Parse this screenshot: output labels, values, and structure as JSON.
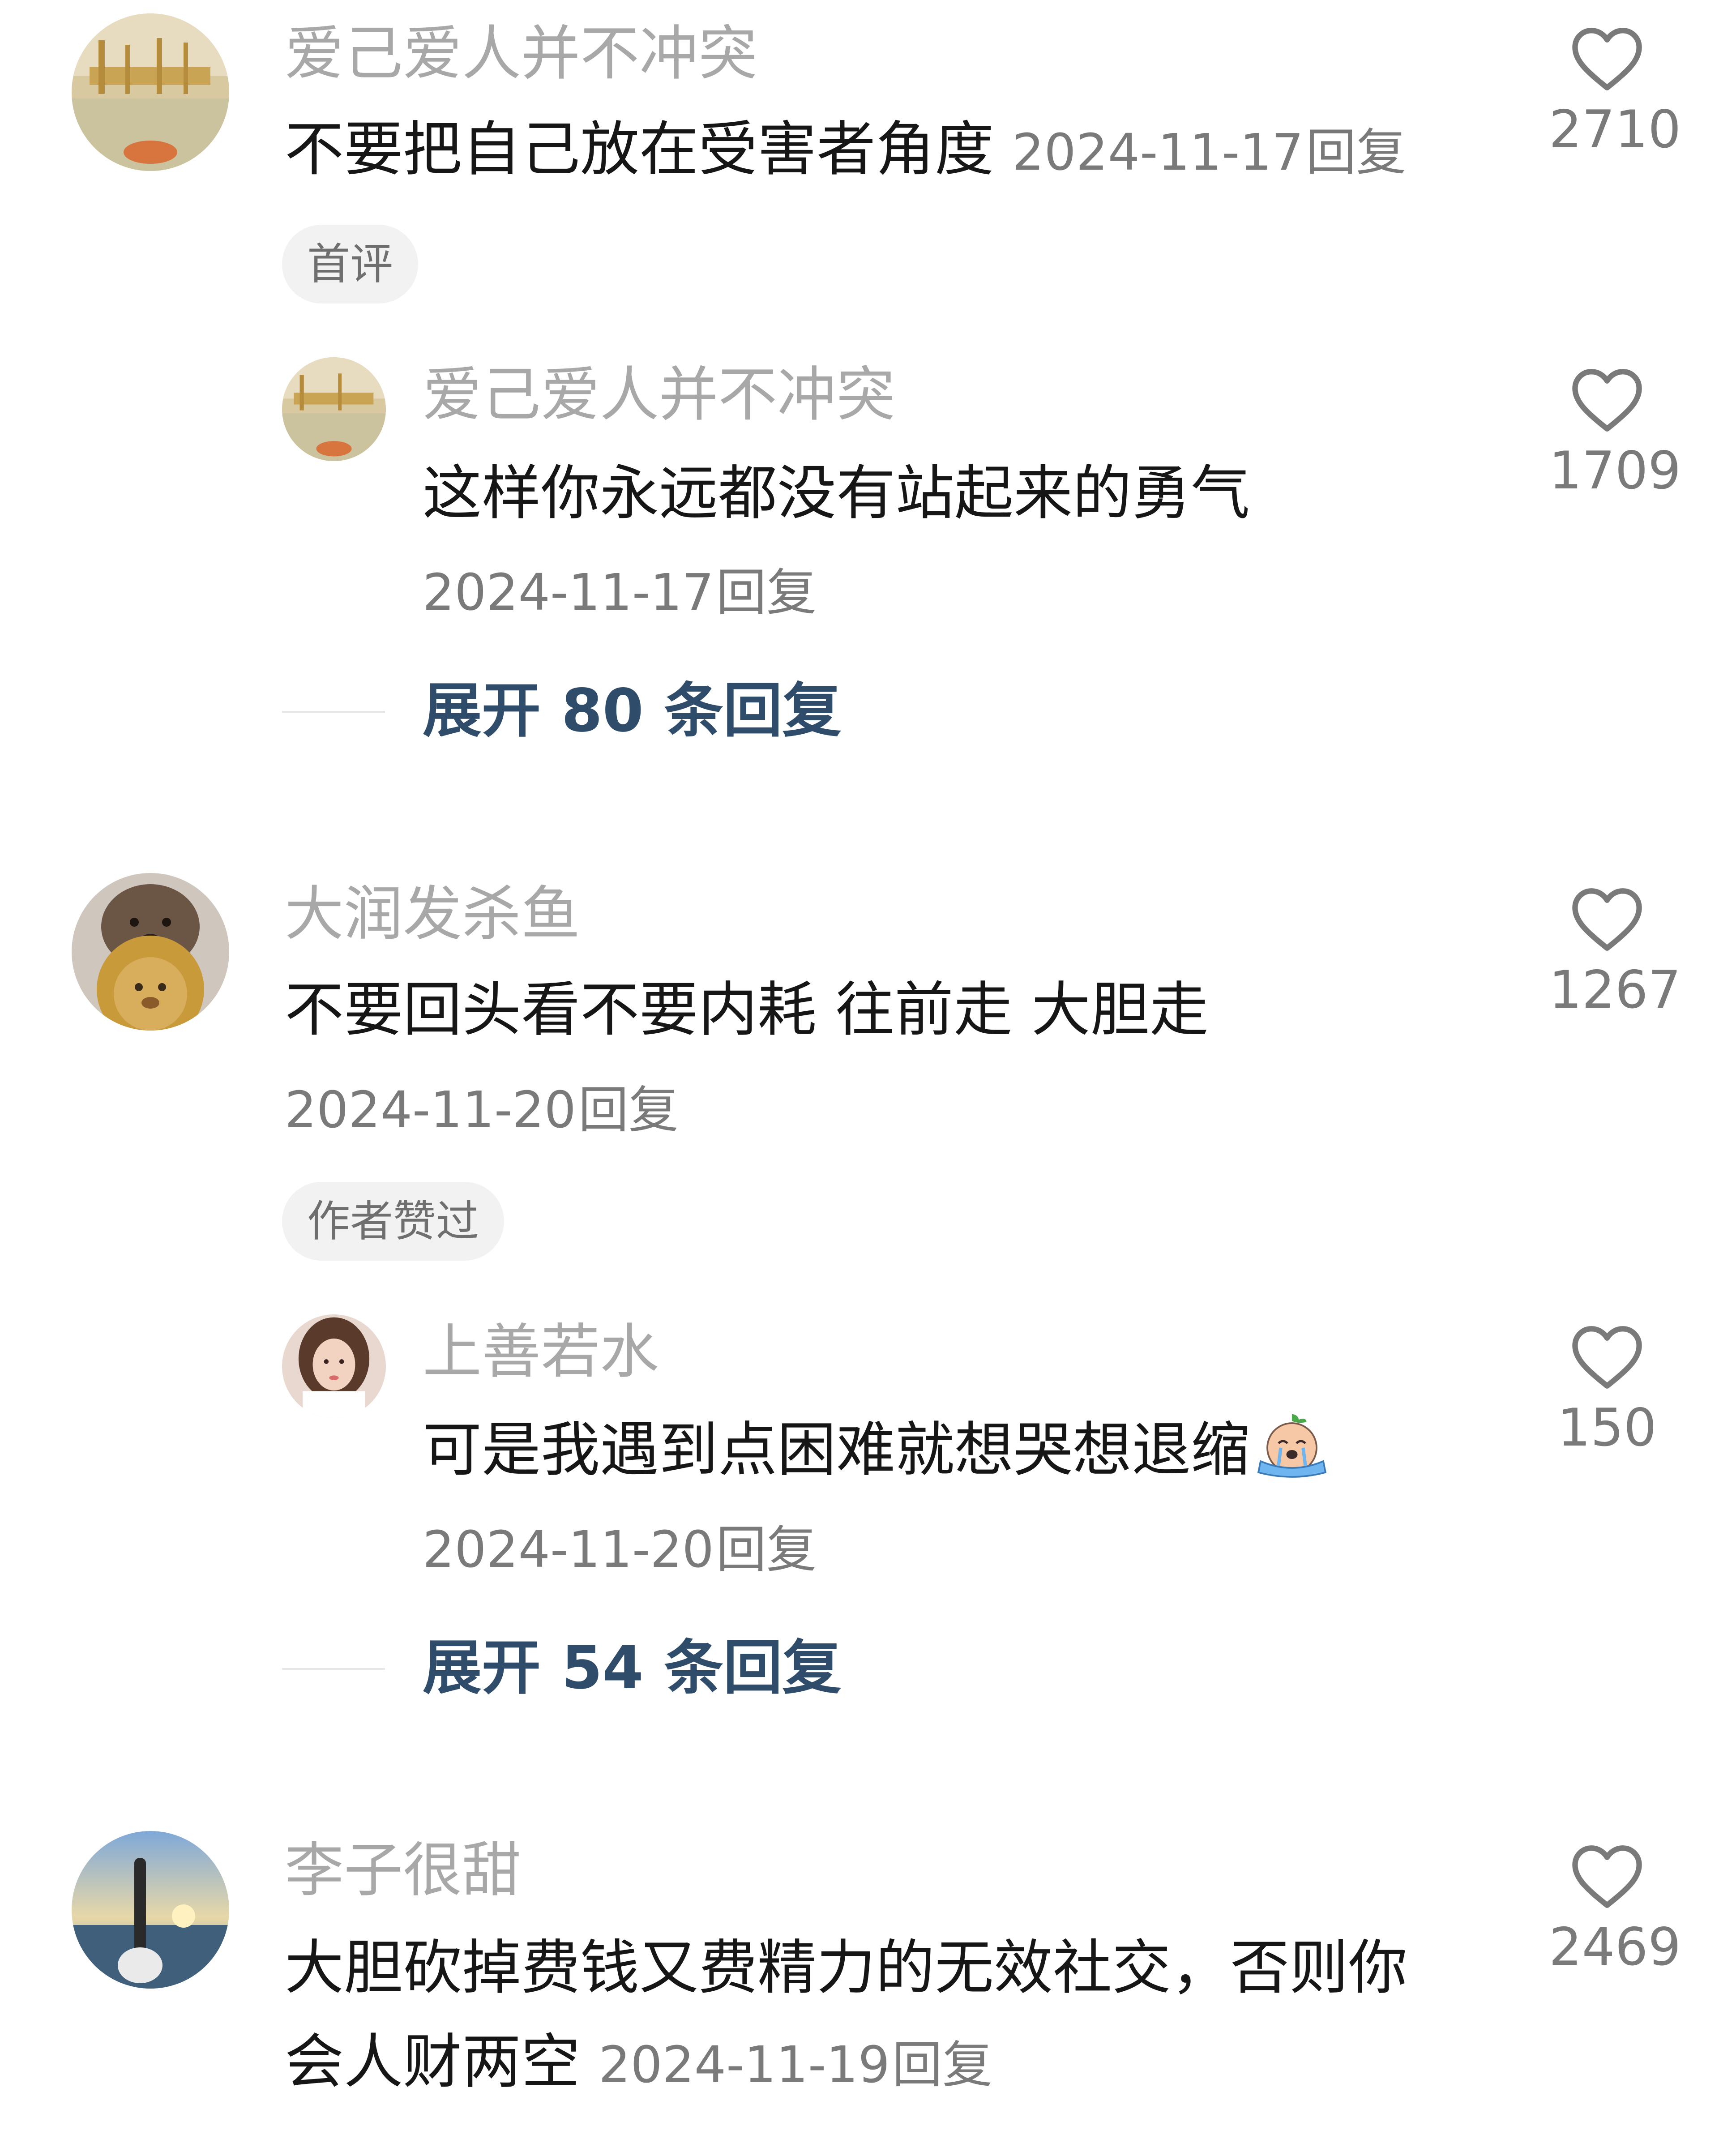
{
  "comments": [
    {
      "username": "爱己爱人并不冲突",
      "text": "不要把自己放在受害者角度",
      "date": "2024-11-17",
      "reply_label": "回复",
      "likes": "2710",
      "tag": "首评",
      "reply": {
        "username": "爱己爱人并不冲突",
        "text": "这样你永远都没有站起来的勇气",
        "date": "2024-11-17",
        "reply_label": "回复",
        "likes": "1709"
      },
      "expand_label": "展开 80 条回复"
    },
    {
      "username": "大润发杀鱼",
      "text": "不要回头看不要内耗 往前走 大胆走",
      "date": "2024-11-20",
      "reply_label": "回复",
      "likes": "1267",
      "tag": "作者赞过",
      "reply": {
        "username": "上善若水",
        "text": "可是我遇到点困难就想哭想退缩",
        "date": "2024-11-20",
        "reply_label": "回复",
        "likes": "150"
      },
      "expand_label": "展开 54 条回复"
    },
    {
      "username": "李子很甜",
      "text_line1": "大胆砍掉费钱又费精力的无效社交，否则你",
      "text_line2": "会人财两空",
      "date": "2024-11-19",
      "reply_label": "回复",
      "likes": "2469"
    }
  ],
  "icons": {
    "like": "heart-outline-icon",
    "emoji": "crying-emoji-icon"
  },
  "colors": {
    "text": "#161616",
    "username": "#a8a8a8",
    "meta": "#7a7a7a",
    "link": "#2f4d6a",
    "tag_bg": "#f2f2f2"
  }
}
